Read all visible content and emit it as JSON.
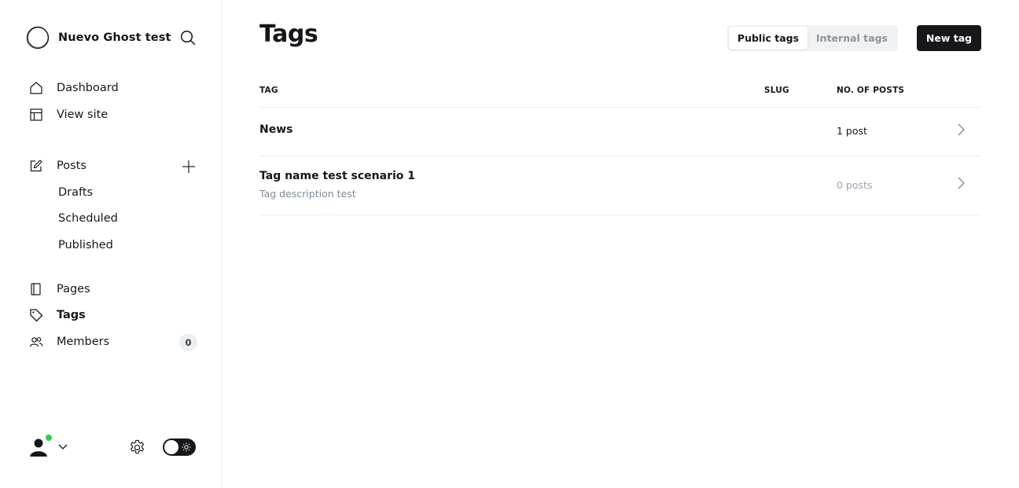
{
  "sidebar": {
    "site_title": "Nuevo Ghost test",
    "nav": [
      {
        "label": "Dashboard",
        "icon": "home-icon"
      },
      {
        "label": "View site",
        "icon": "layout-icon"
      }
    ],
    "posts": {
      "label": "Posts",
      "icon": "edit-icon",
      "sub_items": [
        "Drafts",
        "Scheduled",
        "Published"
      ]
    },
    "nav2": [
      {
        "label": "Pages",
        "icon": "page-icon"
      },
      {
        "label": "Tags",
        "icon": "tag-icon",
        "active": true
      },
      {
        "label": "Members",
        "icon": "members-icon",
        "badge": "0"
      }
    ]
  },
  "header": {
    "title": "Tags",
    "tabs": [
      {
        "label": "Public tags",
        "selected": true
      },
      {
        "label": "Internal tags",
        "selected": false
      }
    ],
    "new_button": "New tag"
  },
  "table": {
    "columns": [
      "TAG",
      "SLUG",
      "NO. OF POSTS"
    ],
    "rows": [
      {
        "name": "News",
        "description": "",
        "slug": "",
        "posts": "1 post"
      },
      {
        "name": "Tag name test scenario 1",
        "description": "Tag description test",
        "slug": "",
        "posts": "0 posts"
      }
    ]
  },
  "colors": {
    "accent": "#15171a",
    "online": "#30cf43",
    "muted": "#7c8b9a",
    "divider": "#ebeef0"
  }
}
